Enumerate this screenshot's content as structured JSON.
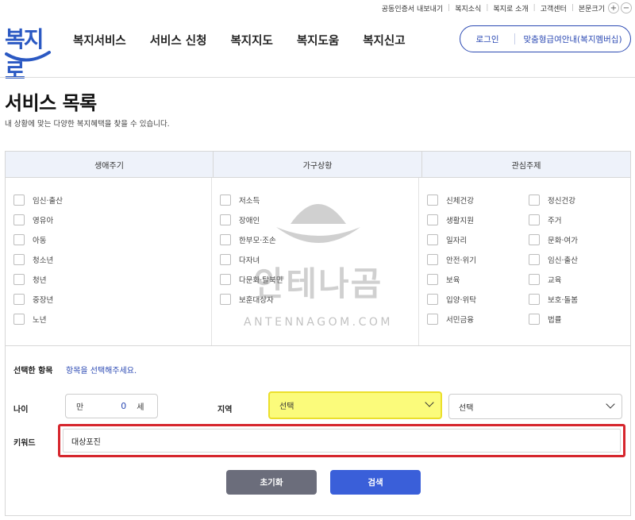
{
  "utility": {
    "items": [
      "공동인증서 내보내기",
      "복지소식",
      "복지로 소개",
      "고객센터",
      "본문크기"
    ],
    "zoom_in": "+",
    "zoom_out": "−"
  },
  "logo": {
    "text": "복지로"
  },
  "nav": {
    "items": [
      "복지서비스",
      "서비스 신청",
      "복지지도",
      "복지도움",
      "복지신고"
    ]
  },
  "account": {
    "login": "로그인",
    "guide": "맞춤형급여안내(복지멤버십)"
  },
  "page": {
    "title": "서비스 목록",
    "description": "내 상황에 맞는 다양한 복지혜택을 찾을 수 있습니다."
  },
  "filters": {
    "headers": [
      "생애주기",
      "가구상황",
      "관심주제"
    ],
    "life_cycle": [
      "임신·출산",
      "영유아",
      "아동",
      "청소년",
      "청년",
      "중장년",
      "노년"
    ],
    "household": [
      "저소득",
      "장애인",
      "한부모·조손",
      "다자녀",
      "다문화·탈북민",
      "보훈대상자"
    ],
    "topics_left": [
      "신체건강",
      "생활지원",
      "일자리",
      "안전·위기",
      "보육",
      "입양·위탁",
      "서민금융"
    ],
    "topics_right": [
      "정신건강",
      "주거",
      "문화·여가",
      "임신·출산",
      "교육",
      "보호·돌봄",
      "법률"
    ]
  },
  "selected": {
    "label": "선택한 항목",
    "placeholder": "항목을 선택해주세요."
  },
  "age": {
    "label": "나이",
    "prefix": "만",
    "value": "0",
    "suffix": "세"
  },
  "region": {
    "label": "지역",
    "select1": "선택",
    "select2": "선택"
  },
  "keyword": {
    "label": "키워드",
    "value": "대상포진"
  },
  "buttons": {
    "reset": "초기화",
    "search": "검색"
  },
  "watermark": {
    "text": "안테나곰",
    "sub": "ANTENNAGOM.COM"
  },
  "colors": {
    "accent": "#2b49b3",
    "search_button": "#3a5fd9",
    "reset_button": "#6b6d7b",
    "highlight_yellow": "#fbfb7b",
    "highlight_red": "#d6262d"
  }
}
